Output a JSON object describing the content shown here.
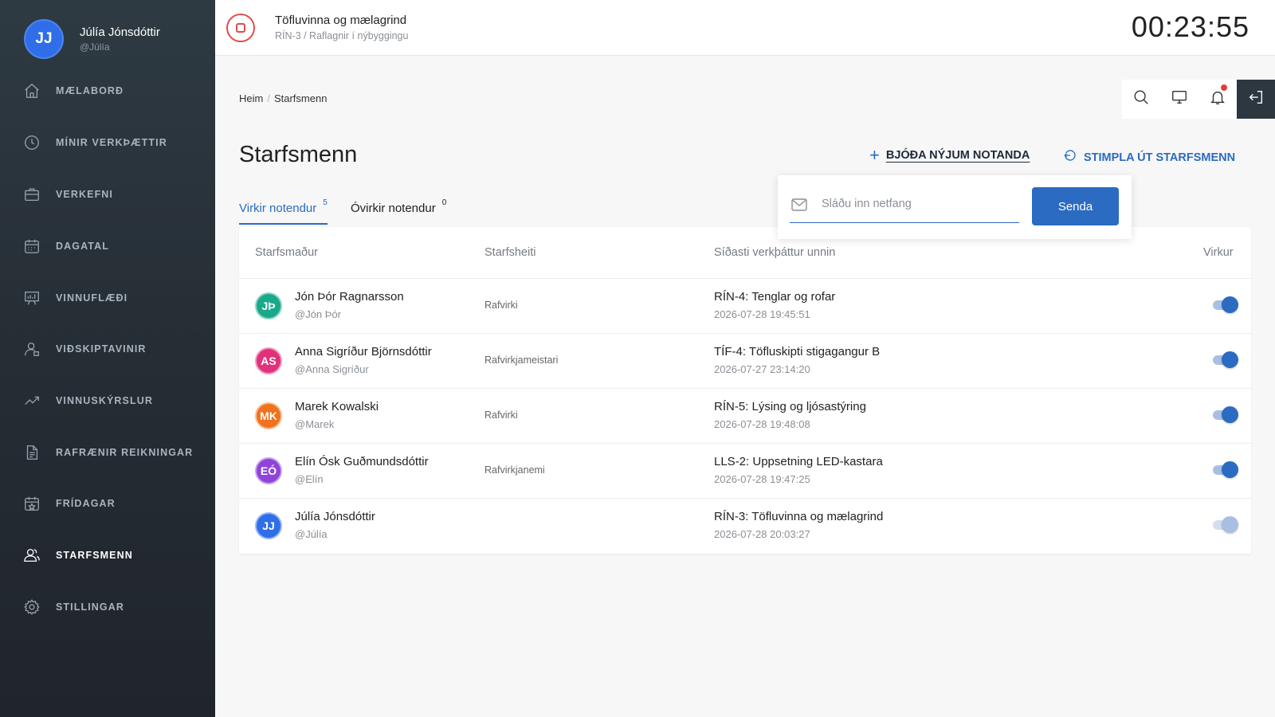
{
  "user": {
    "initials": "JJ",
    "name": "Júlía Jónsdóttir",
    "handle": "@Júlía"
  },
  "sidebar": {
    "items": [
      {
        "label": "MÆLABORÐ",
        "icon": "home-icon"
      },
      {
        "label": "MÍNIR VERKÞÆTTIR",
        "icon": "clock-icon"
      },
      {
        "label": "VERKEFNI",
        "icon": "briefcase-icon"
      },
      {
        "label": "DAGATAL",
        "icon": "calendar-icon"
      },
      {
        "label": "VINNUFLÆÐI",
        "icon": "presentation-icon"
      },
      {
        "label": "VIÐSKIPTAVINIR",
        "icon": "customer-icon"
      },
      {
        "label": "VINNUSKÝRSLUR",
        "icon": "trend-icon"
      },
      {
        "label": "RAFRÆNIR REIKNINGAR",
        "icon": "document-icon"
      },
      {
        "label": "FRÍDAGAR",
        "icon": "calendar-star-icon"
      },
      {
        "label": "STARFSMENN",
        "icon": "users-icon",
        "active": true
      },
      {
        "label": "STILLINGAR",
        "icon": "gear-icon"
      }
    ]
  },
  "topbar": {
    "task_title": "Töfluvinna og mælagrind",
    "task_sub": "RÍN-3 / Raflagnir í nýbyggingu",
    "timer": "00:23:55"
  },
  "breadcrumb": {
    "home": "Heim",
    "current": "Starfsmenn"
  },
  "page": {
    "title": "Starfsmenn",
    "invite_label": "BJÓÐA NÝJUM NOTANDA",
    "clockout_label": "STIMPLA ÚT STARFSMENN"
  },
  "tabs": [
    {
      "label": "Virkir notendur",
      "count": "5"
    },
    {
      "label": "Óvirkir notendur",
      "count": "0"
    }
  ],
  "table": {
    "headers": {
      "employee": "Starfsmaður",
      "title": "Starfsheiti",
      "last_task": "Síðasti verkþáttur unnin",
      "active": "Virkur"
    },
    "rows": [
      {
        "initials": "JÞ",
        "color": "#1aa88a",
        "name": "Jón Þór Ragnarsson",
        "handle": "@Jón Þór",
        "job": "Rafvirki",
        "task": "RÍN-4: Tenglar og rofar",
        "time": "2026-07-28 19:45:51",
        "active": true
      },
      {
        "initials": "AS",
        "color": "#e0327a",
        "name": "Anna Sigríður Björnsdóttir",
        "handle": "@Anna Sigríður",
        "job": "Rafvirkjameistari",
        "task": "TÍF-4: Töfluskipti stigagangur B",
        "time": "2026-07-27 23:14:20",
        "active": true
      },
      {
        "initials": "MK",
        "color": "#f0721e",
        "name": "Marek Kowalski",
        "handle": "@Marek",
        "job": "Rafvirki",
        "task": "RÍN-5: Lýsing og ljósastýring",
        "time": "2026-07-28 19:48:08",
        "active": true
      },
      {
        "initials": "EÓ",
        "color": "#8e44d9",
        "name": "Elín Ósk Guðmundsdóttir",
        "handle": "@Elín",
        "job": "Rafvirkjanemi",
        "task": "LLS-2: Uppsetning LED-kastara",
        "time": "2026-07-28 19:47:25",
        "active": true
      },
      {
        "initials": "JJ",
        "color": "#2f6ee8",
        "name": "Júlía Jónsdóttir",
        "handle": "@Júlía",
        "job": "",
        "task": "RÍN-3: Töfluvinna og mælagrind",
        "time": "2026-07-28 20:03:27",
        "active": true,
        "disabled": true
      }
    ]
  },
  "invite": {
    "placeholder": "Sláðu inn netfang",
    "send_label": "Senda"
  },
  "colors": {
    "accent": "#2b6bc2",
    "sidebar_bg": "#2a333a",
    "stop_red": "#e14b4b",
    "notification_dot": "#e23d3d"
  }
}
